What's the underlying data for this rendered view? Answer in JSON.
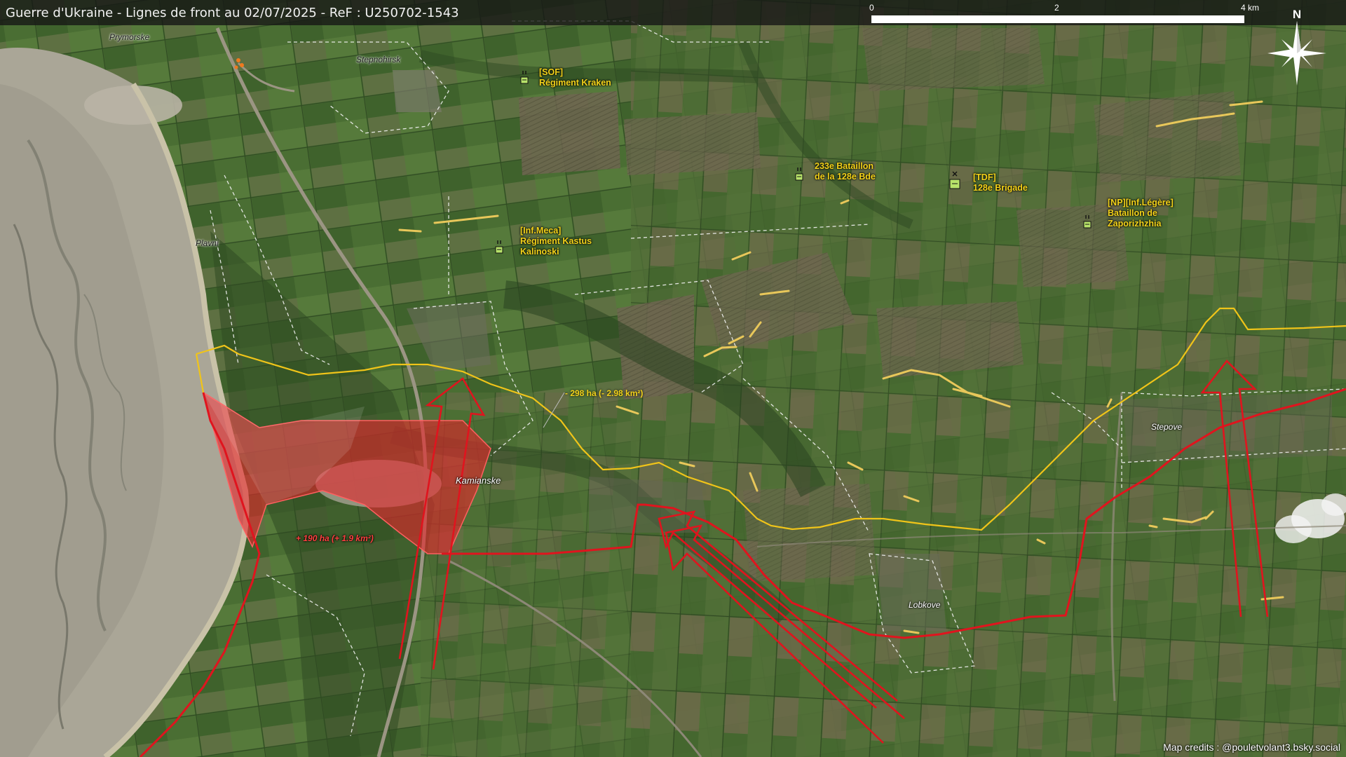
{
  "title": "Guerre d'Ukraine - Lignes de front au 02/07/2025 - ReF : U250702-1543",
  "scale": {
    "labels": [
      "0",
      "2",
      "4 km"
    ]
  },
  "north": {
    "label": "N"
  },
  "places": [
    {
      "id": "prymorske",
      "name": "Prymorske"
    },
    {
      "id": "stepnohirsk",
      "name": "Stepnohirsk"
    },
    {
      "id": "plavni",
      "name": "Plavni"
    },
    {
      "id": "kamianske",
      "name": "Kamianske"
    },
    {
      "id": "stepove",
      "name": "Stepove"
    },
    {
      "id": "lobkove",
      "name": "Lobkove"
    }
  ],
  "units": [
    {
      "id": "sof",
      "lines": [
        "[SOF]",
        "Régiment Kraken"
      ]
    },
    {
      "id": "bat233",
      "lines": [
        "233e Bataillon",
        "de la 128e Bde"
      ]
    },
    {
      "id": "tdf",
      "lines": [
        "[TDF]",
        "128e Brigade"
      ]
    },
    {
      "id": "np",
      "lines": [
        "[NP][Inf.Légère]",
        "Bataillon de",
        "Zaporizhzhia"
      ]
    },
    {
      "id": "kastus",
      "lines": [
        "[Inf.Meca]",
        "Régiment Kastus",
        "Kalinoski"
      ]
    }
  ],
  "areas": {
    "loss": "- 298 ha (- 2.98 km²)",
    "gain": "+ 190 ha (+ 1.9 km²)"
  },
  "colors": {
    "ukraine_line": "#f0c419",
    "russia_line": "#e0141e",
    "gain_fill": "#e8242c",
    "unit_text": "#f3d21a",
    "lagoon": "#a9a497",
    "fields": "#466a30"
  },
  "credits": "Map credits : @pouletvolant3.bsky.social"
}
